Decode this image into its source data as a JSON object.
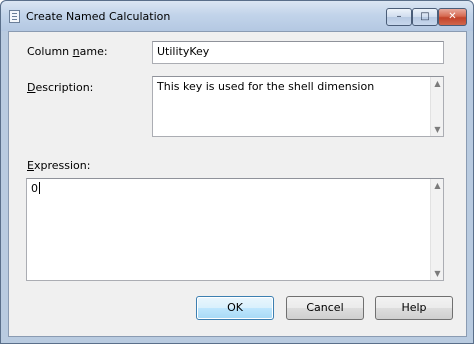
{
  "window": {
    "title": "Create Named Calculation",
    "controls": {
      "minimize": "–",
      "maximize": "□",
      "close": "✕"
    }
  },
  "form": {
    "column_name": {
      "label_pre": "Column ",
      "label_key": "n",
      "label_post": "ame:",
      "value": "UtilityKey"
    },
    "description": {
      "label_key": "D",
      "label_post": "escription:",
      "value": "This key is used for the shell dimension"
    },
    "expression": {
      "label_key": "E",
      "label_post": "xpression:",
      "value": "0"
    }
  },
  "buttons": {
    "ok": "OK",
    "cancel": "Cancel",
    "help": "Help"
  },
  "icons": {
    "window_icon": "calculator-icon",
    "scroll_up": "▲",
    "scroll_down": "▼"
  },
  "colors": {
    "frame": "#b9cbe0",
    "client": "#f0f0f0",
    "close_button": "#c2432a",
    "default_button_border": "#3c7fb1"
  }
}
